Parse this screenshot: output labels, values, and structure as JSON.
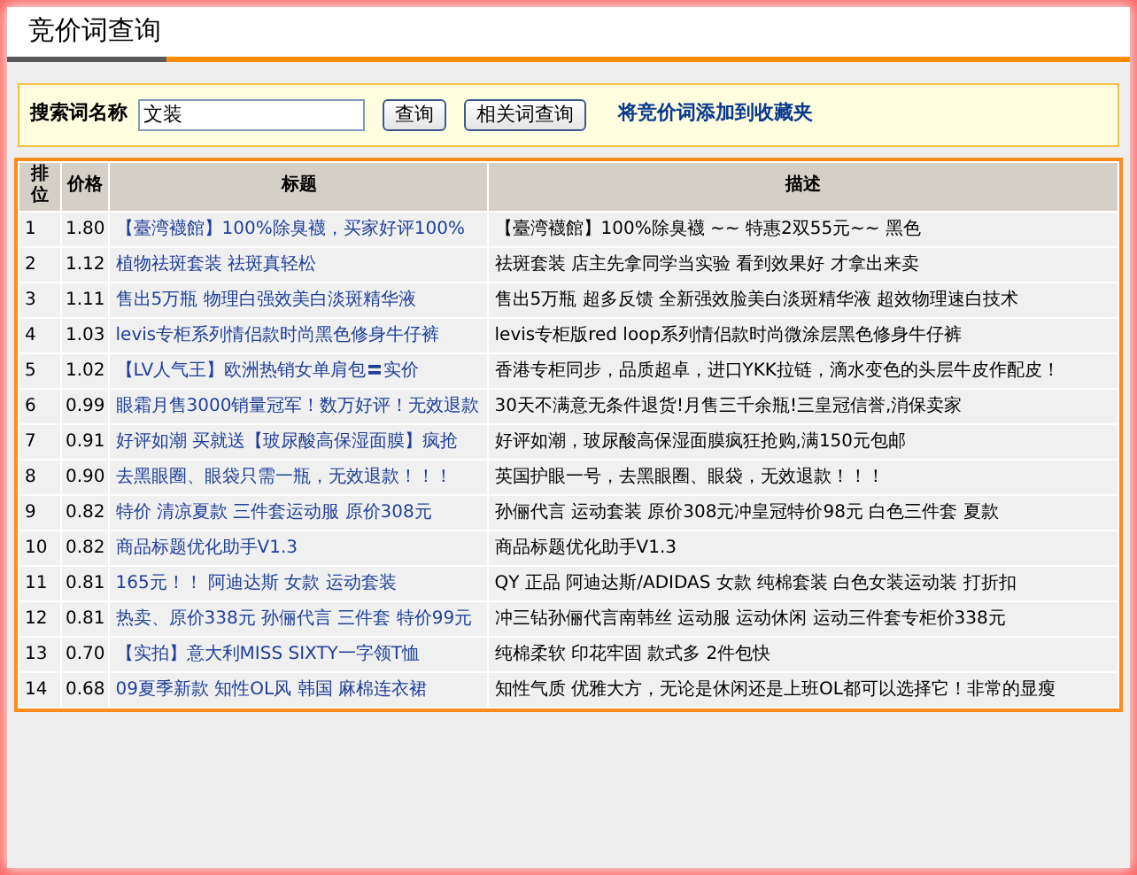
{
  "page_title": "竞价词查询",
  "search": {
    "label": "搜索词名称",
    "value": "文装",
    "buttons": [
      "查询",
      "相关词查询"
    ],
    "link": "将竞价词添加到收藏夹"
  },
  "table": {
    "columns": [
      "排位",
      "价格",
      "标题",
      "描述"
    ],
    "rows": [
      {
        "rank": "1",
        "price": "1.80",
        "title": "【臺湾襪館】100%除臭襪，买家好评100%",
        "description": "【臺湾襪館】100%除臭襪 ~~ 特惠2双55元~~ 黑色"
      },
      {
        "rank": "2",
        "price": "1.12",
        "title": "植物祛斑套装 祛斑真轻松",
        "description": "祛斑套装 店主先拿同学当实验 看到效果好 才拿出来卖"
      },
      {
        "rank": "3",
        "price": "1.11",
        "title": "售出5万瓶 物理白强效美白淡斑精华液",
        "description": "售出5万瓶 超多反馈 全新强效脸美白淡斑精华液 超效物理速白技术"
      },
      {
        "rank": "4",
        "price": "1.03",
        "title": "levis专柜系列情侣款时尚黑色修身牛仔裤",
        "description": "levis专柜版red loop系列情侣款时尚微涂层黑色修身牛仔裤"
      },
      {
        "rank": "5",
        "price": "1.02",
        "title": "【LV人气王】欧洲热销女单肩包〓实价",
        "description": "香港专柜同步，品质超卓，进口YKK拉链，滴水变色的头层牛皮作配皮！"
      },
      {
        "rank": "6",
        "price": "0.99",
        "title": "眼霜月售3000销量冠军！数万好评！无效退款",
        "description": "30天不满意无条件退货!月售三千余瓶!三皇冠信誉,消保卖家"
      },
      {
        "rank": "7",
        "price": "0.91",
        "title": "好评如潮 买就送【玻尿酸高保湿面膜】疯抢",
        "description": "好评如潮，玻尿酸高保湿面膜疯狂抢购,满150元包邮"
      },
      {
        "rank": "8",
        "price": "0.90",
        "title": "去黑眼圈、眼袋只需一瓶，无效退款！！！",
        "description": "英国护眼一号，去黑眼圈、眼袋，无效退款！！！"
      },
      {
        "rank": "9",
        "price": "0.82",
        "title": "特价 清凉夏款 三件套运动服 原价308元",
        "description": "孙俪代言 运动套装 原价308元冲皇冠特价98元 白色三件套 夏款"
      },
      {
        "rank": "10",
        "price": "0.82",
        "title": "商品标题优化助手V1.3",
        "description": "商品标题优化助手V1.3"
      },
      {
        "rank": "11",
        "price": "0.81",
        "title": "165元！！ 阿迪达斯 女款 运动套装",
        "description": "QY 正品 阿迪达斯/ADIDAS 女款 纯棉套装 白色女装运动装 打折扣"
      },
      {
        "rank": "12",
        "price": "0.81",
        "title": "热卖、原价338元 孙俪代言 三件套 特价99元",
        "description": "冲三钻孙俪代言南韩丝 运动服 运动休闲 运动三件套专柜价338元"
      },
      {
        "rank": "13",
        "price": "0.70",
        "title": "【实拍】意大利MISS SIXTY一字领T恤",
        "description": "纯棉柔软 印花牢固 款式多 2件包快"
      },
      {
        "rank": "14",
        "price": "0.68",
        "title": "09夏季新款 知性OL风 韩国 麻棉连衣裙",
        "description": "知性气质 优雅大方，无论是休闲还是上班OL都可以选择它！非常的显瘦"
      }
    ]
  }
}
